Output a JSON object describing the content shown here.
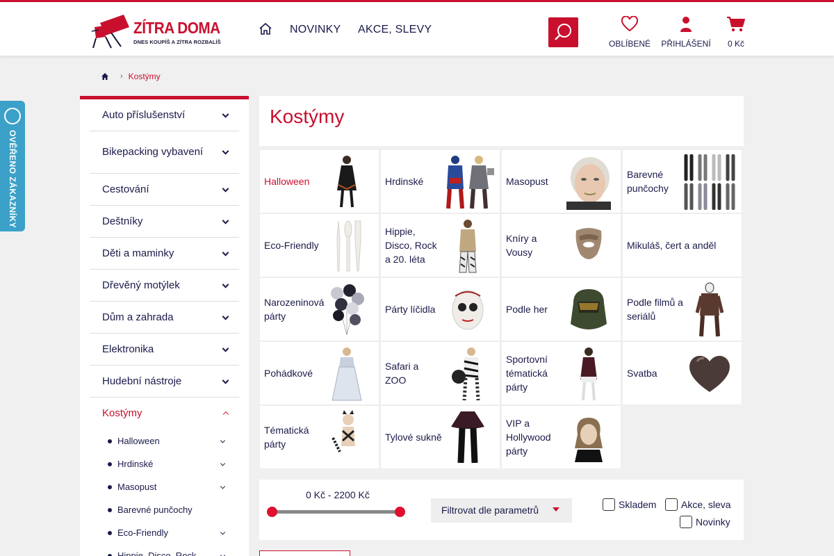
{
  "header": {
    "logo_name": "ZÍTRA DOMA",
    "logo_tagline": "DNES KOUPÍŠ A ZÍTRA ROZBALÍŠ",
    "nav": [
      "NOVINKY",
      "AKCE, SLEVY"
    ],
    "favorites_label": "OBLÍBENÉ",
    "login_label": "PŘIHLÁŠENÍ",
    "cart_label": "0 Kč"
  },
  "verified_badge": "OVĚŘENO ZÁKAZNÍKY",
  "breadcrumb": {
    "current": "Kostýmy"
  },
  "sidebar": {
    "categories": [
      "Auto příslušenství",
      "Bikepacking vybavení",
      "Cestování",
      "Deštníky",
      "Děti a maminky",
      "Dřevěný motýlek",
      "Dům a zahrada",
      "Elektronika",
      "Hudební nástroje",
      "Kostýmy"
    ],
    "subcategories": [
      "Halloween",
      "Hrdinské",
      "Masopust",
      "Barevné punčochy",
      "Eco-Friendly",
      "Hippie, Disco, Rock"
    ]
  },
  "main": {
    "title": "Kostýmy",
    "tiles": [
      "Halloween",
      "Hrdinské",
      "Masopust",
      "Barevné punčochy",
      "Eco-Friendly",
      "Hippie, Disco, Rock a 20. léta",
      "Kníry a Vousy",
      "Mikuláš, čert a anděl",
      "Narozeninová párty",
      "Párty líčidla",
      "Podle her",
      "Podle filmů a seriálů",
      "Pohádkové",
      "Safari a ZOO",
      "Sportovní tématická párty",
      "Svatba",
      "Tématická párty",
      "Tylové sukně",
      "VIP a Hollywood párty"
    ]
  },
  "filter": {
    "price_range": "0 Kč - 2200 Kč",
    "price_min": 0,
    "price_max": 2200,
    "select_label": "Filtrovat dle parametrů",
    "checkbox_stock": "Skladem",
    "checkbox_sale": "Akce, sleva",
    "checkbox_new": "Novinky"
  },
  "colors": {
    "accent": "#c8102e",
    "text": "#1a1a4a",
    "badge": "#3ba1c8"
  }
}
